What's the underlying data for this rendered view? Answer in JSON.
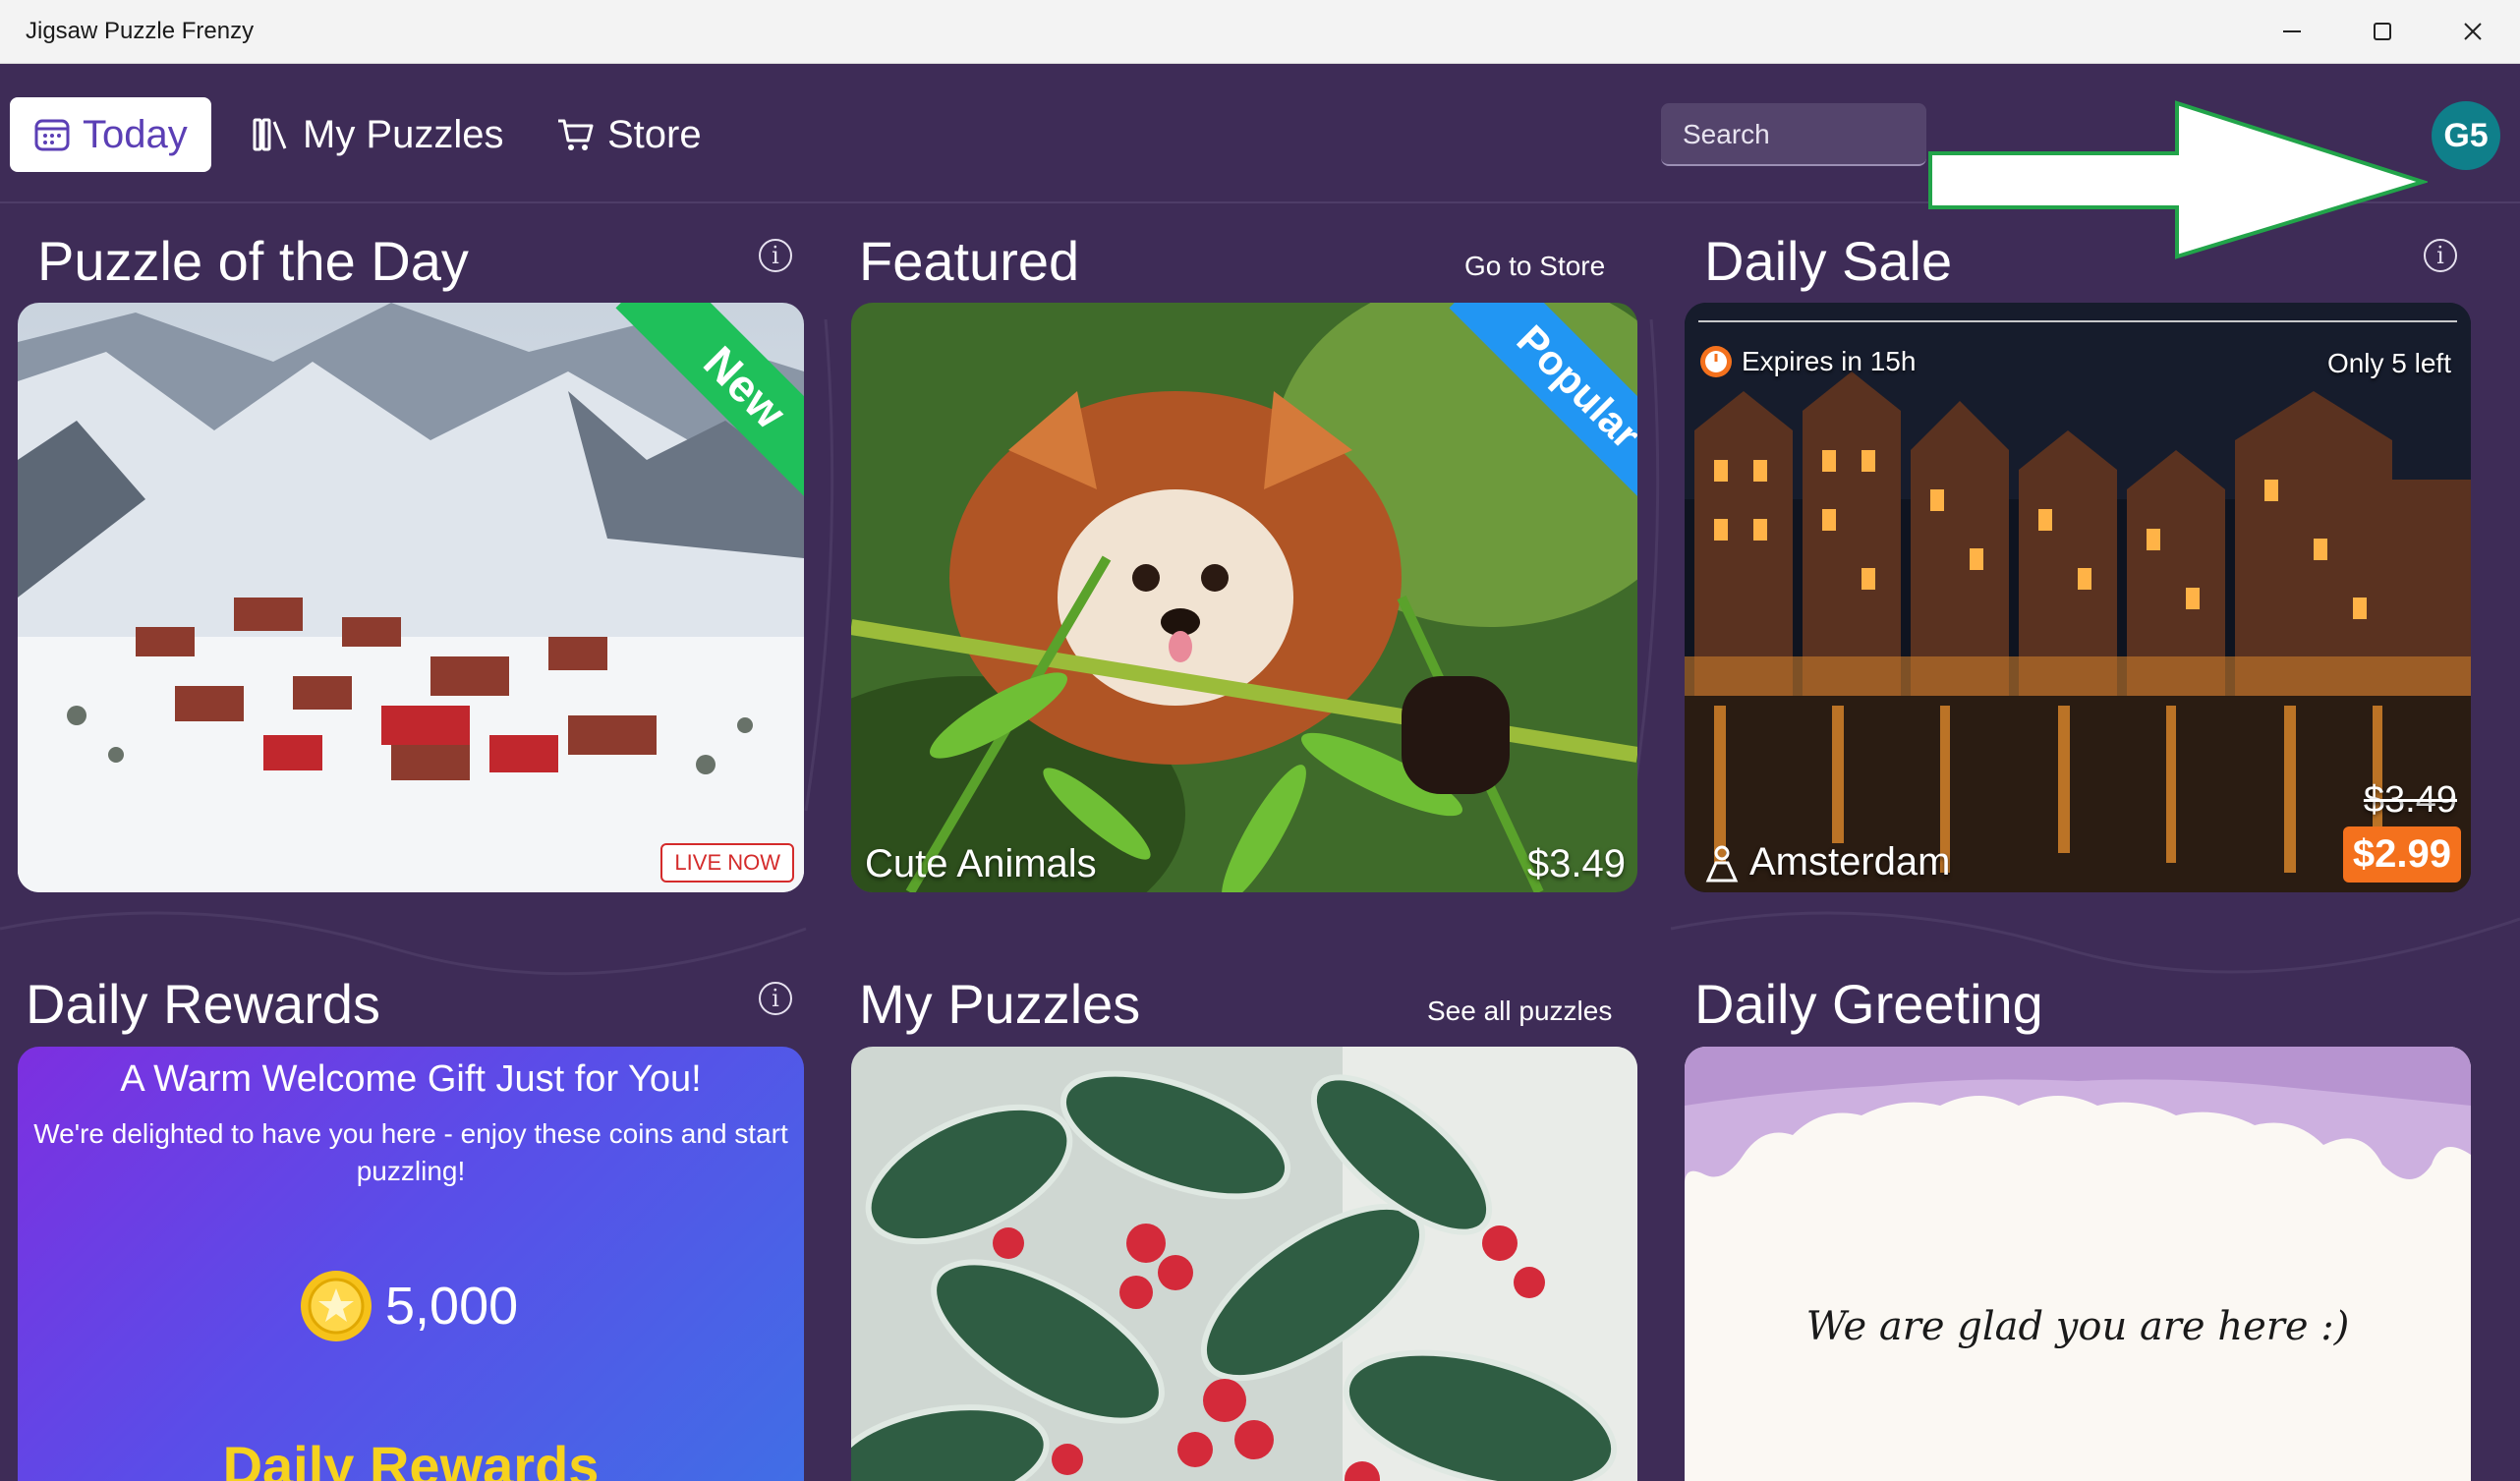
{
  "window": {
    "title": "Jigsaw Puzzle Frenzy"
  },
  "nav": {
    "tabs": [
      {
        "label": "Today",
        "active": true
      },
      {
        "label": "My Puzzles"
      },
      {
        "label": "Store"
      }
    ],
    "search_placeholder": "Search",
    "avatar_initials": "G5"
  },
  "puzzle_of_day": {
    "title": "Puzzle of the Day",
    "ribbon": "New",
    "badge": "LIVE NOW"
  },
  "featured": {
    "title": "Featured",
    "link": "Go to Store",
    "ribbon": "Popular",
    "name": "Cute Animals",
    "price": "$3.49"
  },
  "daily_sale": {
    "title": "Daily Sale",
    "expires": "Expires in 15h",
    "stock": "Only 5 left",
    "name": "Amsterdam",
    "old_price": "$3.49",
    "price": "$2.99"
  },
  "daily_rewards": {
    "title": "Daily Rewards",
    "heading": "A Warm Welcome Gift Just for You!",
    "text": "We're delighted to have you here - enjoy these coins and start puzzling!",
    "coins": "5,000",
    "footer": "Daily Rewards"
  },
  "my_puzzles": {
    "title": "My Puzzles",
    "link": "See all puzzles"
  },
  "daily_greeting": {
    "title": "Daily Greeting",
    "message": "We are glad you are here :)"
  },
  "colors": {
    "background": "#3e2c57",
    "accent": "#5b3fb5",
    "new_ribbon": "#1fc05a",
    "popular_ribbon": "#2196f3",
    "sale": "#f4711d",
    "avatar": "#0f7f8a",
    "live": "#d42b2b"
  }
}
